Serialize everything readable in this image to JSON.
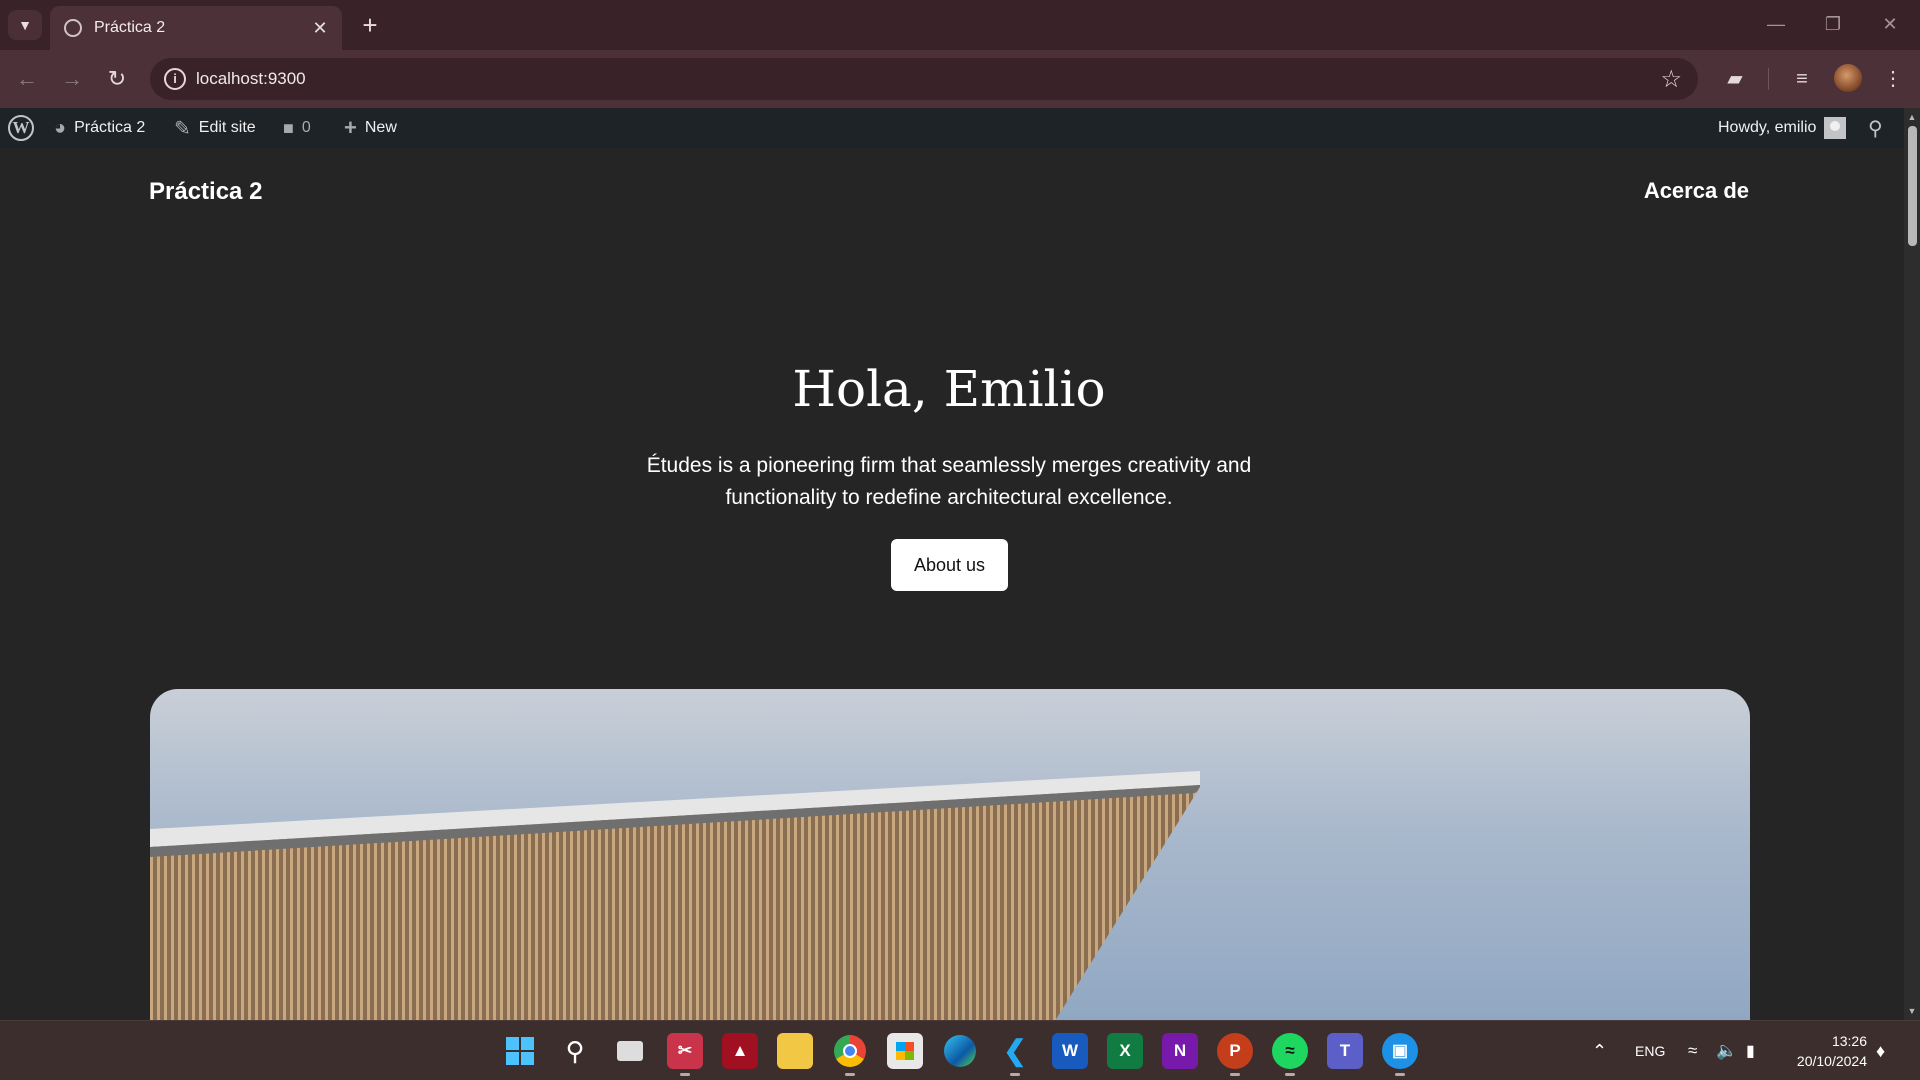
{
  "browser": {
    "tab_title": "Práctica 2",
    "url": "localhost:9300"
  },
  "wp_admin_bar": {
    "site_name": "Práctica 2",
    "edit_site": "Edit site",
    "comments_count": "0",
    "new_label": "New",
    "howdy": "Howdy, emilio"
  },
  "site": {
    "title": "Práctica 2",
    "nav_link": "Acerca de",
    "hero_heading": "Hola, Emilio",
    "hero_text": "Études is a pioneering firm that seamlessly merges creativity and functionality to redefine architectural excellence.",
    "hero_button": "About us"
  },
  "taskbar": {
    "apps": [
      "windows-start",
      "search",
      "task-view",
      "snipping-tool",
      "app",
      "file-explorer",
      "chrome",
      "microsoft-store",
      "edge",
      "vscode",
      "word",
      "excel",
      "onenote",
      "powerpoint",
      "spotify",
      "teams",
      "docker"
    ],
    "language": "ENG",
    "time": "13:26",
    "date": "20/10/2024"
  }
}
